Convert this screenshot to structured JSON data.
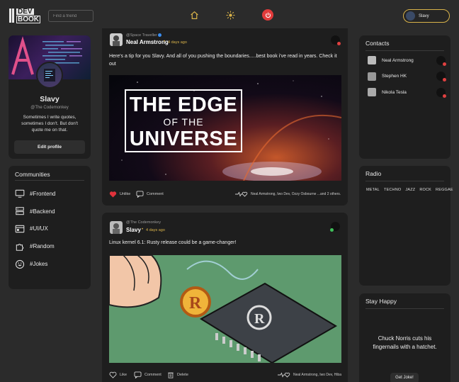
{
  "header": {
    "logo_top": "DEV",
    "logo_bottom": "BOOK",
    "search_placeholder": "Find a friend",
    "user_name": "Slavy"
  },
  "profile": {
    "name": "Slavy",
    "handle": "@The Codemonkey",
    "bio": "Sometimes I write quotes, sometimes I don't. But don't quote me on that.",
    "edit_label": "Edit profile"
  },
  "communities": {
    "title": "Communities",
    "items": [
      "#Frontend",
      "#Backend",
      "#UI/UX",
      "#Random",
      "#Jokes"
    ]
  },
  "posts": [
    {
      "subtitle": "@Space Traveller",
      "author": "Neal Armstrong",
      "time": "4 days ago",
      "text": "Here's a tip for you Slavy. And all of you pushing the boundaries.....best book i've read in years. Check it out",
      "book_line1": "THE EDGE",
      "book_line2": "OF THE",
      "book_line3": "UNIVERSE",
      "actions": [
        "Unlike",
        "Comment"
      ],
      "likes": "Neal Armstrong, Iwo Dev, Ozzy Osbourne ...and 2 others."
    },
    {
      "subtitle": "@The Codemonkey",
      "author": "Slavy",
      "time": "4 days ago",
      "text": "Linux kernel 6.1: Rusty release could be a game-changer!",
      "actions": [
        "Like",
        "Comment",
        "Delete"
      ],
      "likes": "Neal Armstrong, Iwo Dev, Hiba"
    }
  ],
  "contacts": {
    "title": "Contacts",
    "items": [
      "Neal Armstrong",
      "Stephen HK",
      "Nikola Tesla"
    ]
  },
  "radio": {
    "title": "Radio",
    "genres": [
      "METAL",
      "TECHNO",
      "JAZZ",
      "ROCK",
      "REGGAE"
    ]
  },
  "happy": {
    "title": "Stay Happy",
    "joke": "Chuck Norris cuts his fingernails with a hatchet.",
    "button": "Get Joke!"
  },
  "colors": {
    "accent": "#d9b34a",
    "power": "#e23b3b",
    "heart": "#e0323b",
    "online": "#3fbf5a",
    "offline": "#e04040"
  }
}
